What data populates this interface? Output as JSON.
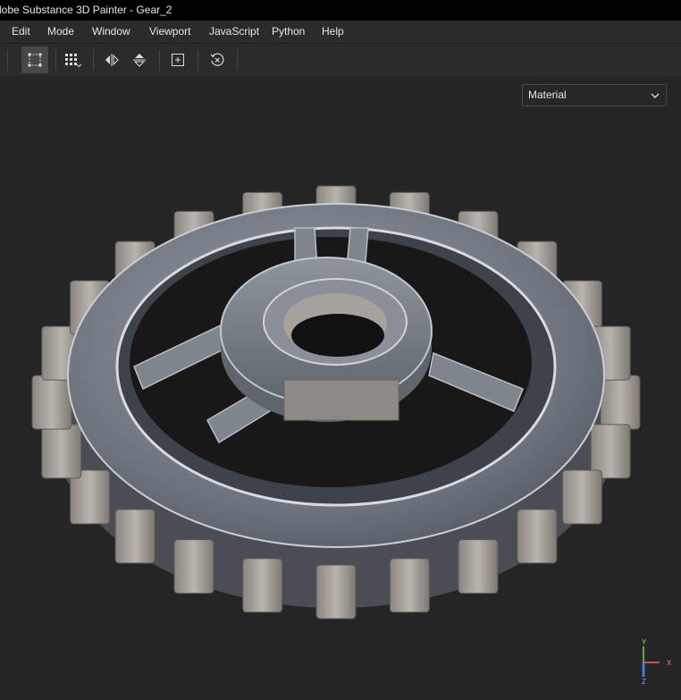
{
  "window": {
    "title": "dobe Substance 3D Painter - Gear_2"
  },
  "menu": {
    "items": [
      "Edit",
      "Mode",
      "Window",
      "Viewport",
      "JavaScript",
      "Python",
      "Help"
    ]
  },
  "toolbar": {
    "buttons": [
      {
        "icon": "selection-mode-icon",
        "active": true
      },
      {
        "icon": "grid-options-icon",
        "active": false
      },
      {
        "icon": "mirror-x-icon",
        "active": false
      },
      {
        "icon": "mirror-y-icon",
        "active": false
      },
      {
        "icon": "frame-selection-icon",
        "active": false
      },
      {
        "icon": "reset-camera-icon",
        "active": false
      }
    ]
  },
  "viewport": {
    "display_mode": {
      "selected": "Material"
    },
    "object": {
      "name": "Gear_2"
    }
  },
  "axes": {
    "y": "Y",
    "x": "X",
    "z": "Z"
  },
  "colors": {
    "accent_y": "#4caf50",
    "accent_x": "#d94a4a",
    "accent_z": "#4a7bd9",
    "viewport_bg": "#252525"
  }
}
